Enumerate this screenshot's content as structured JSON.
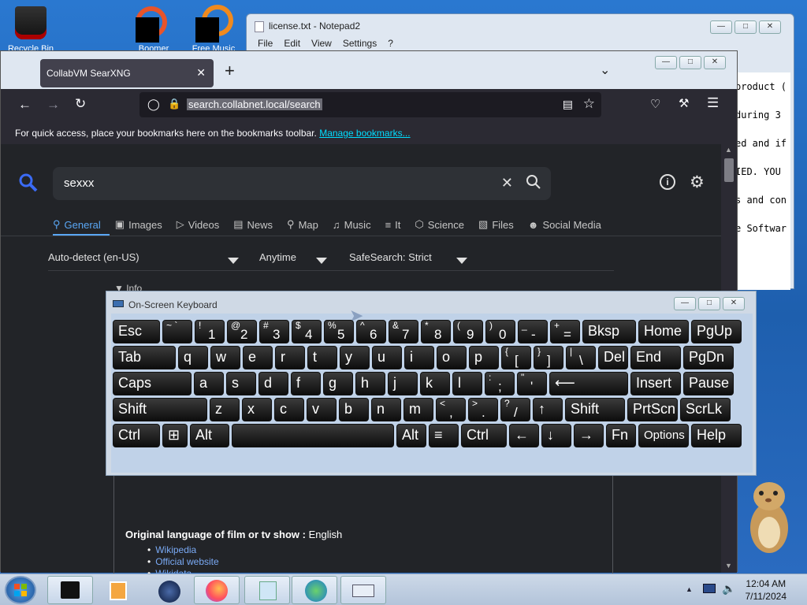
{
  "desktop": {
    "icons": [
      {
        "label": "Recycle Bin"
      },
      {
        "label": "Boomer World"
      },
      {
        "label": "Free Music"
      }
    ]
  },
  "notepad": {
    "title": "license.txt - Notepad2",
    "menu": [
      "File",
      "Edit",
      "View",
      "Settings",
      "?"
    ],
    "text_lines": [
      "product (",
      "during 3",
      "ed and if",
      "IED. YOU",
      "s and con",
      "e Softwar"
    ]
  },
  "browser": {
    "tab_title": "CollabVM SearXNG",
    "url": "search.collabnet.local/search",
    "bookmarks_bar": {
      "text": "For quick access, place your bookmarks here on the bookmarks toolbar.",
      "link": "Manage bookmarks..."
    },
    "search": {
      "query": "sexxx",
      "categories": [
        "General",
        "Images",
        "Videos",
        "News",
        "Map",
        "Music",
        "It",
        "Science",
        "Files",
        "Social Media"
      ],
      "active_category": "General",
      "filters": {
        "language": "Auto-detect (en-US)",
        "time": "Anytime",
        "safesearch": "SafeSearch: Strict"
      },
      "info_label": "Info",
      "infobox": {
        "language_label": "Original language of film or tv show :",
        "language_value": "English",
        "links": [
          "Wikipedia",
          "Official website",
          "Wikidata"
        ]
      }
    }
  },
  "osk": {
    "title": "On-Screen Keyboard",
    "rows": [
      [
        {
          "m": "Esc"
        },
        {
          "s": "~ `"
        },
        {
          "s": "!",
          "b": "1"
        },
        {
          "s": "@",
          "b": "2"
        },
        {
          "s": "#",
          "b": "3"
        },
        {
          "s": "$",
          "b": "4"
        },
        {
          "s": "%",
          "b": "5"
        },
        {
          "s": "^",
          "b": "6"
        },
        {
          "s": "&",
          "b": "7"
        },
        {
          "s": "*",
          "b": "8"
        },
        {
          "s": "(",
          "b": "9"
        },
        {
          "s": ")",
          "b": "0"
        },
        {
          "s": "_",
          "b": "-"
        },
        {
          "s": "+",
          "b": "="
        },
        {
          "m": "Bksp"
        },
        {
          "m": "Home"
        },
        {
          "m": "PgUp"
        }
      ],
      [
        {
          "m": "Tab"
        },
        {
          "m": "q"
        },
        {
          "m": "w"
        },
        {
          "m": "e"
        },
        {
          "m": "r"
        },
        {
          "m": "t"
        },
        {
          "m": "y"
        },
        {
          "m": "u"
        },
        {
          "m": "i"
        },
        {
          "m": "o"
        },
        {
          "m": "p"
        },
        {
          "s": "{",
          "b": "["
        },
        {
          "s": "}",
          "b": "]"
        },
        {
          "s": "|",
          "b": "\\"
        },
        {
          "m": "Del"
        },
        {
          "m": "End"
        },
        {
          "m": "PgDn"
        }
      ],
      [
        {
          "m": "Caps"
        },
        {
          "m": "a"
        },
        {
          "m": "s"
        },
        {
          "m": "d"
        },
        {
          "m": "f"
        },
        {
          "m": "g"
        },
        {
          "m": "h"
        },
        {
          "m": "j"
        },
        {
          "m": "k"
        },
        {
          "m": "l"
        },
        {
          "s": ":",
          "b": ";"
        },
        {
          "s": "\"",
          "b": "'"
        },
        {
          "m": "⟵"
        },
        {
          "m": "Insert"
        },
        {
          "m": "Pause"
        }
      ],
      [
        {
          "m": "Shift"
        },
        {
          "m": "z"
        },
        {
          "m": "x"
        },
        {
          "m": "c"
        },
        {
          "m": "v"
        },
        {
          "m": "b"
        },
        {
          "m": "n"
        },
        {
          "m": "m"
        },
        {
          "s": "<",
          "b": ","
        },
        {
          "s": ">",
          "b": "."
        },
        {
          "s": "?",
          "b": "/"
        },
        {
          "m": "↑"
        },
        {
          "m": "Shift"
        },
        {
          "m": "PrtScn"
        },
        {
          "m": "ScrLk"
        }
      ],
      [
        {
          "m": "Ctrl"
        },
        {
          "m": "⊞"
        },
        {
          "m": "Alt"
        },
        {
          "m": ""
        },
        {
          "m": "Alt"
        },
        {
          "m": "≡"
        },
        {
          "m": "Ctrl"
        },
        {
          "m": "←"
        },
        {
          "m": "↓"
        },
        {
          "m": "→"
        },
        {
          "m": "Fn"
        },
        {
          "m": "Options"
        },
        {
          "m": "Help"
        }
      ]
    ]
  },
  "taskbar": {
    "time": "12:04 AM",
    "date": "7/11/2024"
  },
  "colors": {
    "accent": "#5aa7f5",
    "link": "#00ddff",
    "page_bg": "#222428"
  }
}
